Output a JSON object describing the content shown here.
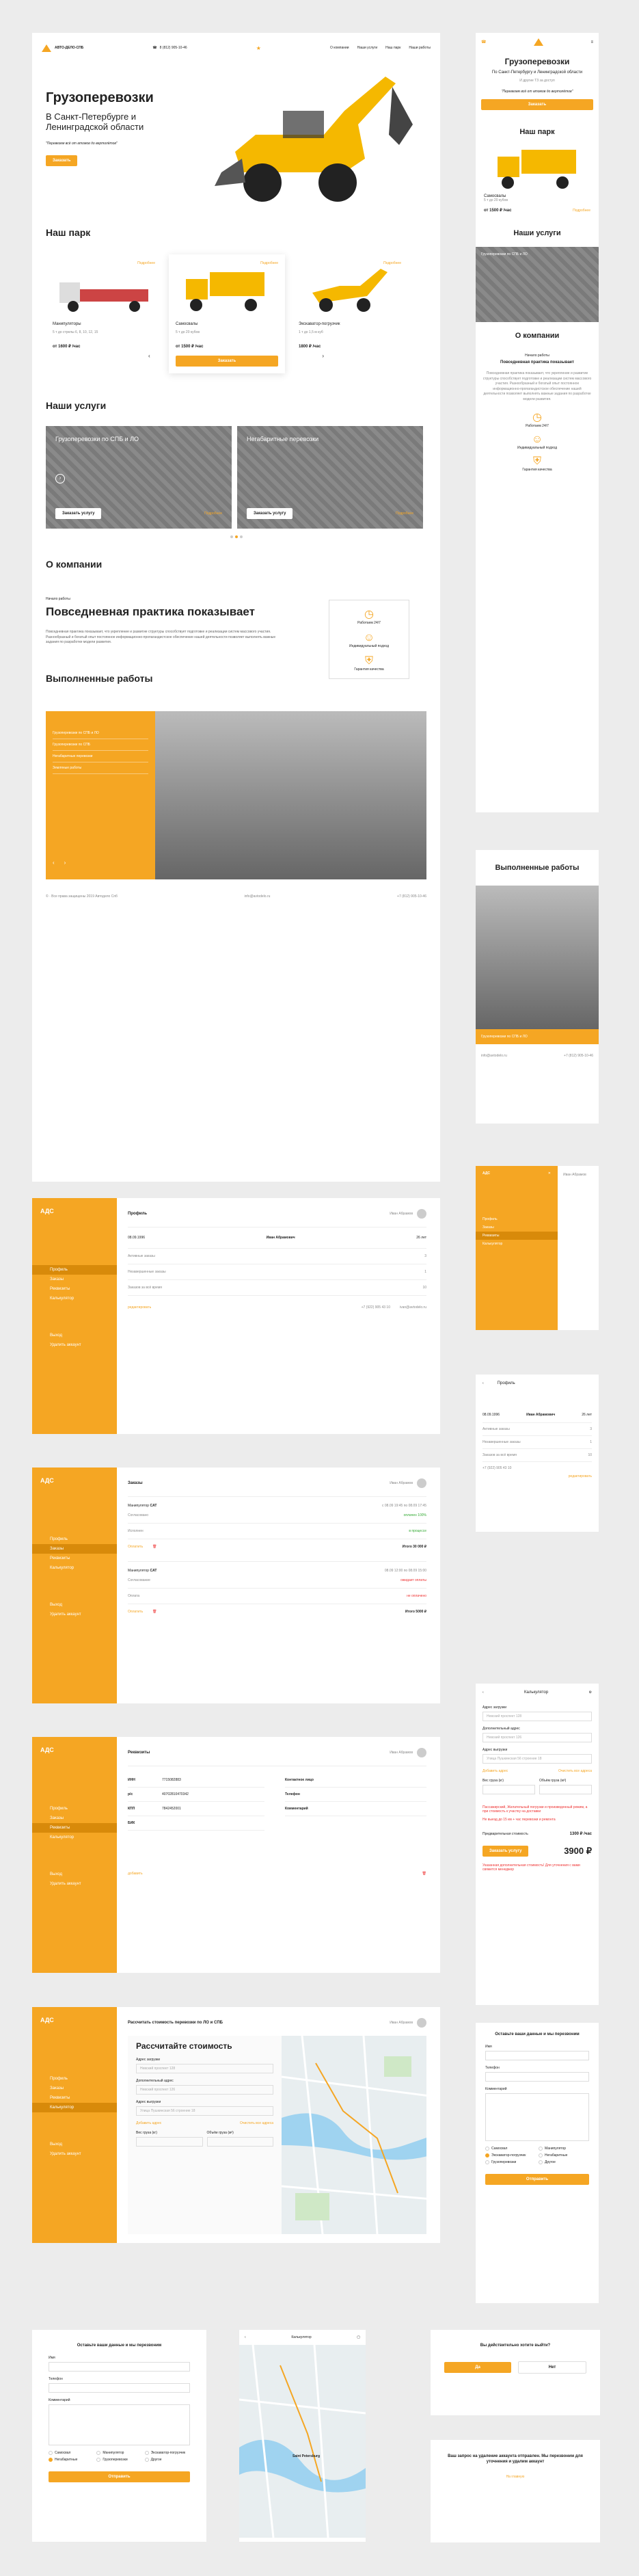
{
  "brand": {
    "logo_text": "АВТО-ДЕЛО-СПБ",
    "phone": "8 (812) 905-10-46",
    "nav": [
      "О компании",
      "Наши услуги",
      "Наш парк",
      "Наши работы"
    ]
  },
  "hero": {
    "title": "Грузоперевозки",
    "subtitle": "В Санкт-Петербурге и Ленинградской области",
    "tagline": "\"Перевезем всё от атомов до вертолётов\"",
    "cta": "Заказать",
    "m_subtitle": "По Санкт-Петербургу и Ленинградской области",
    "m_sub2": "И другие ТЗ за доступ",
    "m_tagline": "\"Перевезем всё от атомов до вертолётов\""
  },
  "park": {
    "title": "Наш парк",
    "items": [
      {
        "name": "Манипуляторы",
        "spec": "5 т до стрелы 6, 8, 10, 12, 15",
        "price": "от 1600 ₽ /час",
        "more": "Подробнее"
      },
      {
        "name": "Самосвалы",
        "spec": "5 т до 20 кубов",
        "price": "от 1500 ₽ /час",
        "more": "Подробнее",
        "cta": "Заказать"
      },
      {
        "name": "Экскаватор-погрузчик",
        "spec": "1 т до 1,5 м куб",
        "price": "1800 ₽ /час",
        "more": "Подробнее"
      }
    ]
  },
  "services": {
    "title": "Наши услуги",
    "items": [
      {
        "name": "Грузоперевозки по СПБ и ЛО",
        "cta": "Заказать услугу",
        "more": "Подробнее"
      },
      {
        "name": "Негабаритные перевозки",
        "cta": "Заказать услугу",
        "more": "Подробнее"
      }
    ]
  },
  "about": {
    "title": "О компании",
    "pre": "Начало работы",
    "head": "Повседневная практика показывает",
    "text": "Повседневная практика показывает, что укрепление и развитие структуры способствует подготовке и реализации систем массового участия. Разнообразный и богатый опыт постоянное информационно-пропагандистское обеспечение нашей деятельности позволяет выполнять важные задания по разработке модели развития.",
    "features": [
      "Работаем 24/7",
      "Индивидуальный подход",
      "Гарантия качества"
    ]
  },
  "works": {
    "title": "Выполненные работы",
    "items": [
      "Грузоперевозки по СПБ и ЛО",
      "Грузоперевозки по СПБ",
      "Негабаритные перевозки",
      "Земляные работы"
    ]
  },
  "footer": {
    "copy": "© · Все права защищены 2019 Автодело Спб",
    "email": "info@avtodelo.ru",
    "phone": "+7 (812) 905-10-46"
  },
  "account": {
    "logo": "АДС",
    "user": "Иван Абрамов",
    "menu": [
      "Профиль",
      "Заказы",
      "Реквизиты",
      "Калькулятор"
    ],
    "bottom": [
      "Выход",
      "Удалить аккаунт"
    ]
  },
  "profile": {
    "title": "Профиль",
    "id": "08.09.1996",
    "name": "Иван Абрамович",
    "age": "26 лет",
    "rows": [
      [
        "Активные заказы",
        "3"
      ],
      [
        "Незавершенные заказы",
        "1"
      ],
      [
        "Заказов за всё время",
        "10"
      ]
    ],
    "edit": "редактировать",
    "phone": "+7 (922) 905 43 10",
    "email": "ivan@avtodelo.ru"
  },
  "orders": {
    "title": "Заказы",
    "list": [
      {
        "type": "Манипулятор",
        "model": "CAT",
        "date": "с 08.09 19:45 по 08.09 17:45",
        "status1": "Согласовано",
        "st1": "оплачен 100%",
        "status2": "Исполнен",
        "st2": "в процессе",
        "pay": "Оплатить",
        "total": "Итого 30 000 ₽"
      },
      {
        "type": "Манипулятор",
        "model": "CAT",
        "date": "08.09 12:00 по 08.09 15:00",
        "status1": "Согласование",
        "st1": "ожидает оплаты",
        "status2": "Оплата",
        "st2": "не оплачено",
        "pay": "Оплатить",
        "total": "Итого 5000 ₽"
      }
    ]
  },
  "reqs": {
    "title": "Реквизиты",
    "fields": [
      [
        "ИНН",
        "7715082883"
      ],
      [
        "р/с",
        "40702810470342"
      ],
      [
        "КПП",
        "7842452001"
      ],
      [
        "БИК",
        ""
      ]
    ],
    "right": [
      "Контактное лицо",
      "Телефон",
      "Комментарий"
    ],
    "edit": "добавить"
  },
  "calc": {
    "title": "Рассчитать стоимость перевозки по ЛО и СПБ",
    "heading": "Рассчитайте стоимость",
    "labels": [
      "Адрес загрузки",
      "Дополнительный адрес",
      "Адрес выгрузки"
    ],
    "values": [
      "Невский проспект 128",
      "Невский проспект 126",
      "Улица Пушкинская 56 строение 18"
    ],
    "add": "Добавить адрес",
    "clear": "Очистить все адреса",
    "weight": "Вес груза (кг)",
    "vol": "Объём груза (м³)",
    "m_title": "Калькулятор",
    "m_notice": "Пассажирский, Желательный погрузки и произведенный режим, а при стоимость к участку на доставки",
    "m_notice2": "Не выезд до 15 км + час перевозки и ремонта",
    "price_label": "Предварительная стоимость",
    "price": "1300 ₽ /час",
    "total": "3900 ₽",
    "order": "Заказать услугу",
    "warn": "Указанная дополнительная стоимость! Для уточнения с вами свяжется менеджер"
  },
  "callback": {
    "title": "Оставьте ваши данные и мы перезвоним",
    "name": "Имя",
    "phone": "Телефон",
    "comment": "Комментарий",
    "checks": [
      "Самосвал",
      "Манипулятор",
      "Экскаватор-погрузчик",
      "Негабаритные",
      "Грузоперевозки",
      "Другое"
    ],
    "send": "Отправить"
  },
  "logout": {
    "q": "Вы действительно хотите выйти?",
    "yes": "Да",
    "no": "Нет"
  },
  "deleted": {
    "msg": "Ваш запрос на удаление аккаунта отправлен. Мы перезвоним для уточнения и удалим аккаунт",
    "link": "На главную"
  },
  "map": {
    "city": "Saint Petersburg"
  },
  "colors": {
    "accent": "#f5a623"
  }
}
